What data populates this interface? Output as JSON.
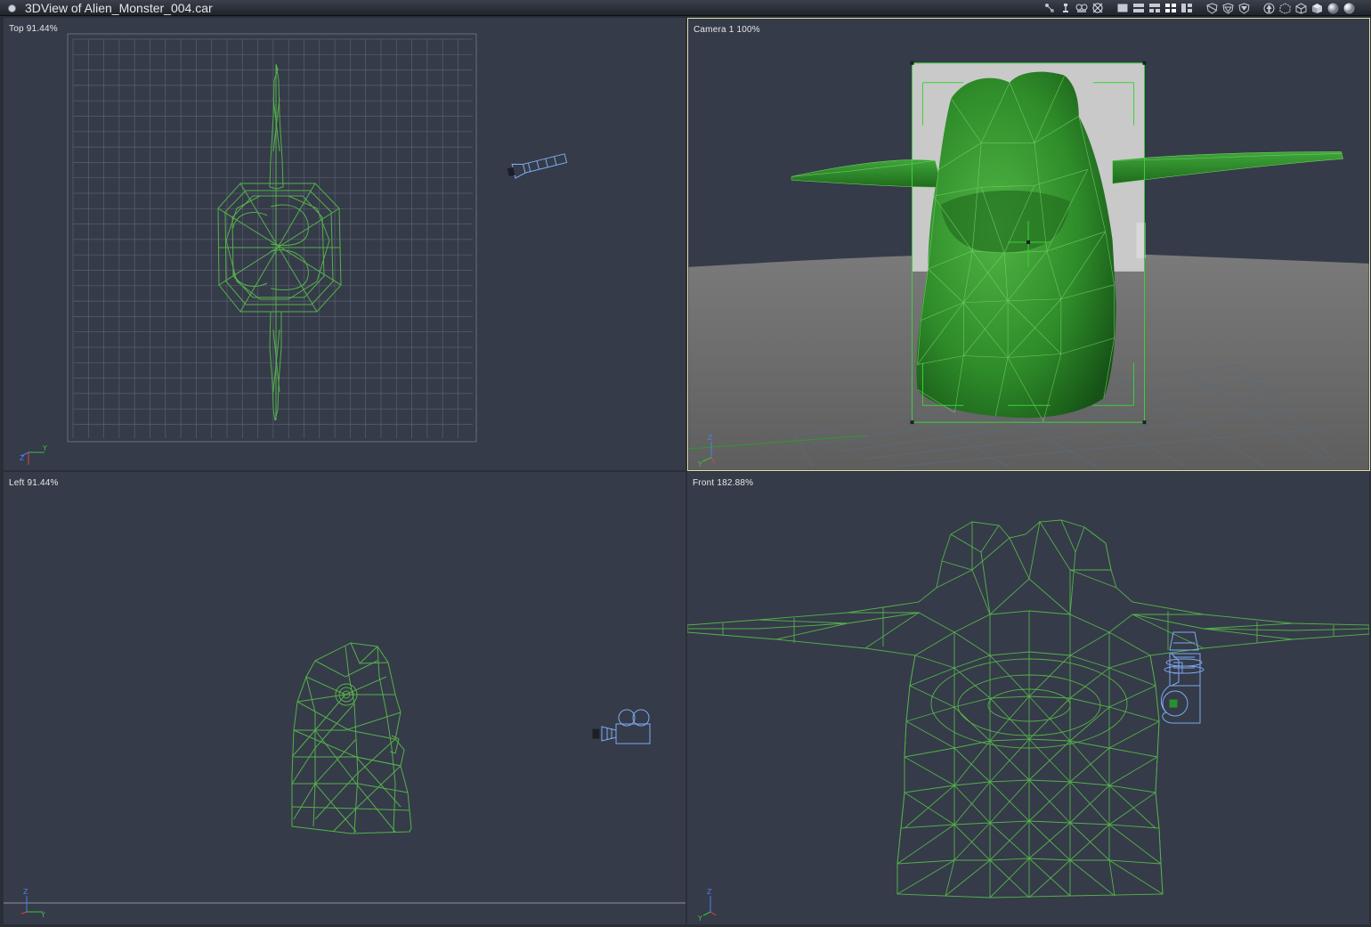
{
  "window": {
    "title": "3DView of Alien_Monster_004.car"
  },
  "toolbar": {
    "icons": [
      "move-tool-icon",
      "light-tool-icon",
      "camera-tool-icon",
      "target-tool-icon",
      "layout-single-icon",
      "layout-two-icon",
      "layout-three-icon",
      "layout-four-icon",
      "layout-custom-icon",
      "shield-bounding-icon",
      "shield-wire-icon",
      "shield-flat-icon",
      "render-arrow-icon",
      "wireframe-box-icon",
      "outline-box-icon",
      "shaded-box-icon",
      "smooth-sphere-icon",
      "textured-sphere-icon"
    ]
  },
  "viewports": {
    "top": {
      "label": "Top 91.44%",
      "axes": [
        "Z",
        "Y"
      ]
    },
    "camera": {
      "label": "Camera 1 100%",
      "axes": [
        "Z",
        "Y"
      ]
    },
    "left": {
      "label": "Left 91.44%",
      "axes": [
        "Z",
        "Y"
      ]
    },
    "front": {
      "label": "Front 182.88%",
      "axes": [
        "Z",
        "Y"
      ]
    }
  },
  "colors": {
    "viewport_bg": "#353b49",
    "wireframe": "#55b04a",
    "grid": "#4f5666",
    "camera_icon": "#7faaf0",
    "active_border": "#e2dfa8",
    "shaded_model": "#2f8a2a"
  }
}
